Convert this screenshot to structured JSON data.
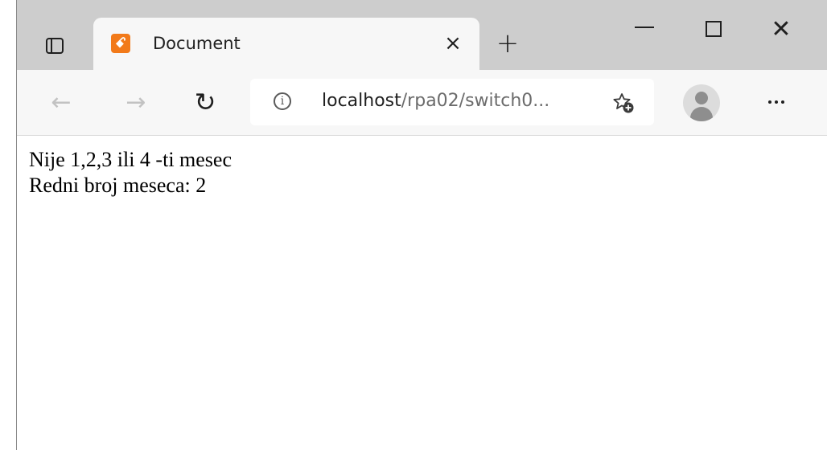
{
  "browser": {
    "tab": {
      "title": "Document",
      "favicon_icon": "xampp-icon",
      "close_glyph": "×"
    },
    "new_tab_glyph": "+",
    "window_controls": {
      "minimize_icon": "minimize-icon",
      "maximize_icon": "maximize-icon",
      "close_glyph": "✕"
    },
    "toolbar": {
      "back_glyph": "←",
      "forward_glyph": "→",
      "reload_glyph": "↻",
      "address": {
        "host": "localhost",
        "path": "/rpa02/switch0...",
        "info_glyph": "i"
      },
      "favorites_icon": "add-favorite-icon",
      "profile_icon": "profile-icon",
      "menu_icon": "more-menu-icon"
    }
  },
  "page": {
    "lines": [
      "Nije 1,2,3 ili 4 -ti mesec",
      "Redni broj meseca: 2"
    ]
  },
  "colors": {
    "tabstrip": "#cdcdcd",
    "toolbar": "#f7f7f7",
    "favicon": "#f27a1a"
  }
}
